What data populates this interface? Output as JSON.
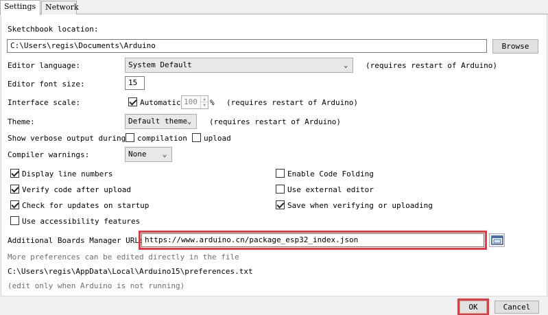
{
  "tabs": [
    {
      "label": "Settings"
    },
    {
      "label": "Network"
    }
  ],
  "sketchbook": {
    "label": "Sketchbook location:",
    "value": "C:\\Users\\regis\\Documents\\Arduino",
    "browse_label": "Browse"
  },
  "editor_language": {
    "label": "Editor language:",
    "value": "System Default",
    "note": "(requires restart of Arduino)"
  },
  "editor_font_size": {
    "label": "Editor font size:",
    "value": "15"
  },
  "interface_scale": {
    "label": "Interface scale:",
    "automatic_label": "Automatic",
    "automatic_checked": true,
    "value": "100",
    "unit": "%",
    "note": "(requires restart of Arduino)"
  },
  "theme": {
    "label": "Theme:",
    "value": "Default theme",
    "note": "(requires restart of Arduino)"
  },
  "verbose": {
    "label": "Show verbose output during:",
    "compilation_label": "compilation",
    "compilation_checked": false,
    "upload_label": "upload",
    "upload_checked": false
  },
  "compiler_warnings": {
    "label": "Compiler warnings:",
    "value": "None"
  },
  "options_left": [
    {
      "label": "Display line numbers",
      "checked": true
    },
    {
      "label": "Verify code after upload",
      "checked": true
    },
    {
      "label": "Check for updates on startup",
      "checked": true
    },
    {
      "label": "Use accessibility features",
      "checked": false
    }
  ],
  "options_right": [
    {
      "label": "Enable Code Folding",
      "checked": false
    },
    {
      "label": "Use external editor",
      "checked": false
    },
    {
      "label": "Save when verifying or uploading",
      "checked": true
    }
  ],
  "boards_manager": {
    "label": "Additional Boards Manager URLs:",
    "value": "https://www.arduino.cn/package_esp32_index.json"
  },
  "footer_notes": {
    "more_prefs": "More preferences can be edited directly in the file",
    "prefs_path": "C:\\Users\\regis\\AppData\\Local\\Arduino15\\preferences.txt",
    "edit_note": "(edit only when Arduino is not running)"
  },
  "buttons": {
    "ok": "OK",
    "cancel": "Cancel"
  },
  "colors": {
    "highlight": "#e8383d",
    "panel": "#ffffff",
    "window": "#f0f0f0"
  }
}
